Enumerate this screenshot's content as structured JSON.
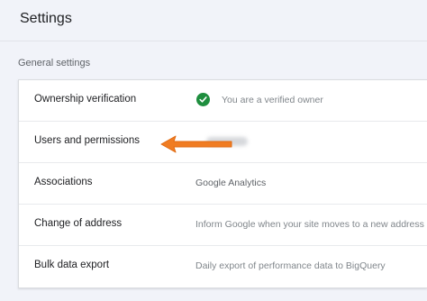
{
  "header": {
    "title": "Settings"
  },
  "general": {
    "section_label": "General settings",
    "rows": [
      {
        "label": "Ownership verification",
        "value": "You are a verified owner",
        "icon": "check-circle-icon",
        "icon_color": "#1e8e3e"
      },
      {
        "label": "Users and permissions",
        "value": ""
      },
      {
        "label": "Associations",
        "value": "Google Analytics"
      },
      {
        "label": "Change of address",
        "value": "Inform Google when your site moves to a new address"
      },
      {
        "label": "Bulk data export",
        "value": "Daily export of performance data to BigQuery"
      }
    ]
  },
  "annotation": {
    "arrow_color": "#f07c22",
    "points_to": "Users and permissions"
  },
  "colors": {
    "page_background": "#f1f3f9",
    "card_background": "#ffffff",
    "divider": "#e8eaed"
  }
}
